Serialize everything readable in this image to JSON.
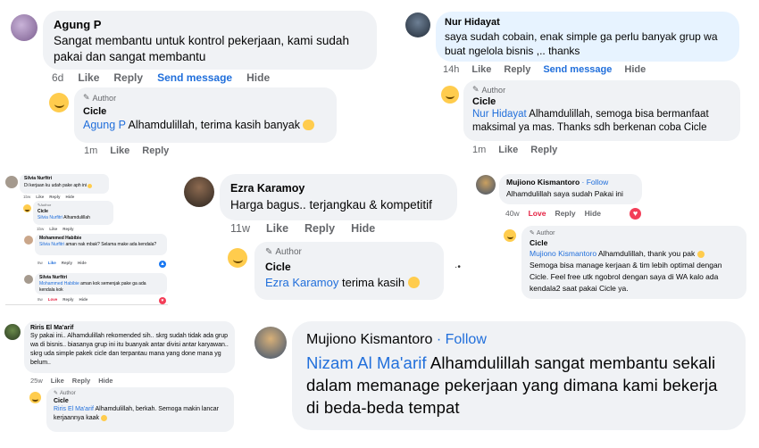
{
  "agung": {
    "name": "Agung P",
    "text": "Sangat membantu untuk kontrol pekerjaan, kami sudah pakai dan sangat membantu",
    "time": "6d",
    "like": "Like",
    "reply": "Reply",
    "send": "Send message",
    "hide": "Hide",
    "r_author": "Author",
    "r_name": "Cicle",
    "r_mention": "Agung P",
    "r_text": " Alhamdulillah, terima kasih banyak",
    "r_time": "1m",
    "r_like": "Like",
    "r_reply": "Reply"
  },
  "nur": {
    "name": "Nur Hidayat",
    "text": "saya sudah cobain, enak simple ga perlu banyak grup wa buat ngelola bisnis ,.. thanks",
    "time": "14h",
    "like": "Like",
    "reply": "Reply",
    "send": "Send message",
    "hide": "Hide",
    "r_author": "Author",
    "r_name": "Cicle",
    "r_mention": "Nur Hidayat",
    "r_text": " Alhamdulillah, semoga bisa bermanfaat maksimal ya mas. Thanks sdh berkenan coba Cicle",
    "r_time": "1m",
    "r_like": "Like",
    "r_reply": "Reply"
  },
  "silvia": {
    "name": "Silvia Nurfitri",
    "text": "Di kerjaan ku udah pake aph ini",
    "time": "1bw",
    "like": "Like",
    "reply": "Reply",
    "hide": "Hide",
    "r1_author": "Author",
    "r1_name": "Cicle",
    "r1_mention": "Silvia Nurfitri",
    "r1_text": " Alhamdulillah",
    "r1_time": "1bw",
    "r1_like": "Like",
    "r1_reply": "Reply",
    "r2_name": "Mohammed Habibie",
    "r2_mention": "Silvia Nurfitri",
    "r2_text": " aman nak mbak? Selama make ada kendala?",
    "r2_time": "8w",
    "r2_like": "Like",
    "r2_reply": "Reply",
    "r2_hide": "Hide",
    "r3_name": "Silvia Nurfitri",
    "r3_mention": "Mohammed Habibie",
    "r3_text": " aman kok semenjak pake ga ada kendala kok",
    "r3_time": "8w",
    "r3_love": "Love",
    "r3_reply": "Reply",
    "r3_hide": "Hide"
  },
  "ezra": {
    "name": "Ezra Karamoy",
    "text": "Harga bagus.. terjangkau & kompetitif",
    "time": "11w",
    "like": "Like",
    "reply": "Reply",
    "hide": "Hide",
    "r_author": "Author",
    "r_name": "Cicle",
    "r_mention": "Ezra Karamoy",
    "r_text": " terima kasih"
  },
  "mujiono1": {
    "name": "Mujiono Kismantoro",
    "follow": "· Follow",
    "text": "Alhamdulillah saya sudah Pakai ini",
    "time": "40w",
    "love": "Love",
    "reply": "Reply",
    "hide": "Hide",
    "r_author": "Author",
    "r_name": "Cicle",
    "r_mention": "Mujiono Kismantoro",
    "r_text": " Alhamdulillah, thank you pak",
    "r_text2": "Semoga bisa manage kerjaan & tim lebih optimal dengan Cicle. Feel free utk ngobrol dengan saya di WA kalo ada kendala2 saat pakai Cicle ya."
  },
  "riris": {
    "name": "Riris El Ma'arif",
    "text": "Sy pakai ini.. Alhamdulillah rekomended sih.. skrg sudah tidak ada grup wa di bisnis.. biasanya grup ini itu buanyak antar divisi antar karyawan.. skrg uda simple pakek cicle dan terpantau mana yang done mana yg belum..",
    "time": "25w",
    "like": "Like",
    "reply": "Reply",
    "hide": "Hide",
    "r_author": "Author",
    "r_name": "Cicle",
    "r_mention": "Riris El Ma'arif",
    "r_text": " Alhamdulillah, berkah. Semoga makin lancar kerjaannya kaak"
  },
  "mujiono2": {
    "name": "Mujiono Kismantoro",
    "follow": "· Follow",
    "mention": "Nizam Al Ma'arif",
    "text": " Alhamdulillah sangat membantu sekali dalam memanage pekerjaan yang dimana kami bekerja di beda-beda tempat"
  }
}
